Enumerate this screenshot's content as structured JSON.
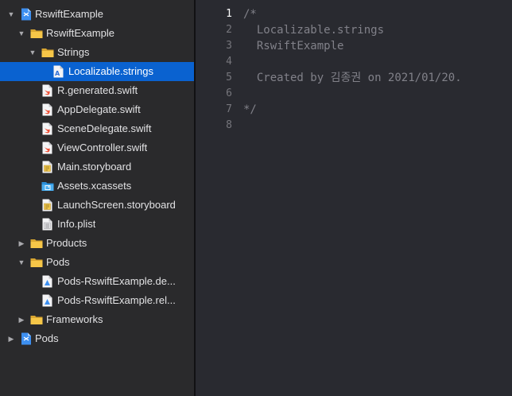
{
  "navigator": {
    "items": [
      {
        "label": "RswiftExample",
        "icon": "project-icon",
        "expanded": true,
        "selected": false
      },
      {
        "label": "RswiftExample",
        "icon": "folder-icon",
        "expanded": true,
        "selected": false
      },
      {
        "label": "Strings",
        "icon": "folder-icon",
        "expanded": true,
        "selected": false
      },
      {
        "label": "Localizable.strings",
        "icon": "strings-file-icon",
        "selected": true
      },
      {
        "label": "R.generated.swift",
        "icon": "swift-file-icon",
        "selected": false
      },
      {
        "label": "AppDelegate.swift",
        "icon": "swift-file-icon",
        "selected": false
      },
      {
        "label": "SceneDelegate.swift",
        "icon": "swift-file-icon",
        "selected": false
      },
      {
        "label": "ViewController.swift",
        "icon": "swift-file-icon",
        "selected": false
      },
      {
        "label": "Main.storyboard",
        "icon": "storyboard-file-icon",
        "selected": false
      },
      {
        "label": "Assets.xcassets",
        "icon": "asset-catalog-icon",
        "selected": false
      },
      {
        "label": "LaunchScreen.storyboard",
        "icon": "storyboard-file-icon",
        "selected": false
      },
      {
        "label": "Info.plist",
        "icon": "plist-file-icon",
        "selected": false
      },
      {
        "label": "Products",
        "icon": "folder-icon",
        "expanded": false,
        "selected": false
      },
      {
        "label": "Pods",
        "icon": "folder-icon",
        "expanded": true,
        "selected": false
      },
      {
        "label": "Pods-RswiftExample.de...",
        "icon": "xcconfig-file-icon",
        "selected": false
      },
      {
        "label": "Pods-RswiftExample.rel...",
        "icon": "xcconfig-file-icon",
        "selected": false
      },
      {
        "label": "Frameworks",
        "icon": "folder-icon",
        "expanded": false,
        "selected": false
      },
      {
        "label": "Pods",
        "icon": "project-icon",
        "expanded": false,
        "selected": false
      }
    ]
  },
  "editor": {
    "current_line": 1,
    "lines": [
      {
        "number": "1",
        "text": "/*"
      },
      {
        "number": "2",
        "text": "  Localizable.strings"
      },
      {
        "number": "3",
        "text": "  RswiftExample"
      },
      {
        "number": "4",
        "text": ""
      },
      {
        "number": "5",
        "text": "  Created by 김종권 on 2021/01/20."
      },
      {
        "number": "6",
        "text": ""
      },
      {
        "number": "7",
        "text": "*/"
      },
      {
        "number": "8",
        "text": ""
      }
    ]
  },
  "colors": {
    "navigator_background": "#2a2a2c",
    "editor_background": "#292a30",
    "selection": "#0a62d0",
    "comment": "#818189",
    "line_number": "#76767c",
    "folder": "#f6c648",
    "swift": "#ef5137",
    "project": "#3d8ff0"
  }
}
